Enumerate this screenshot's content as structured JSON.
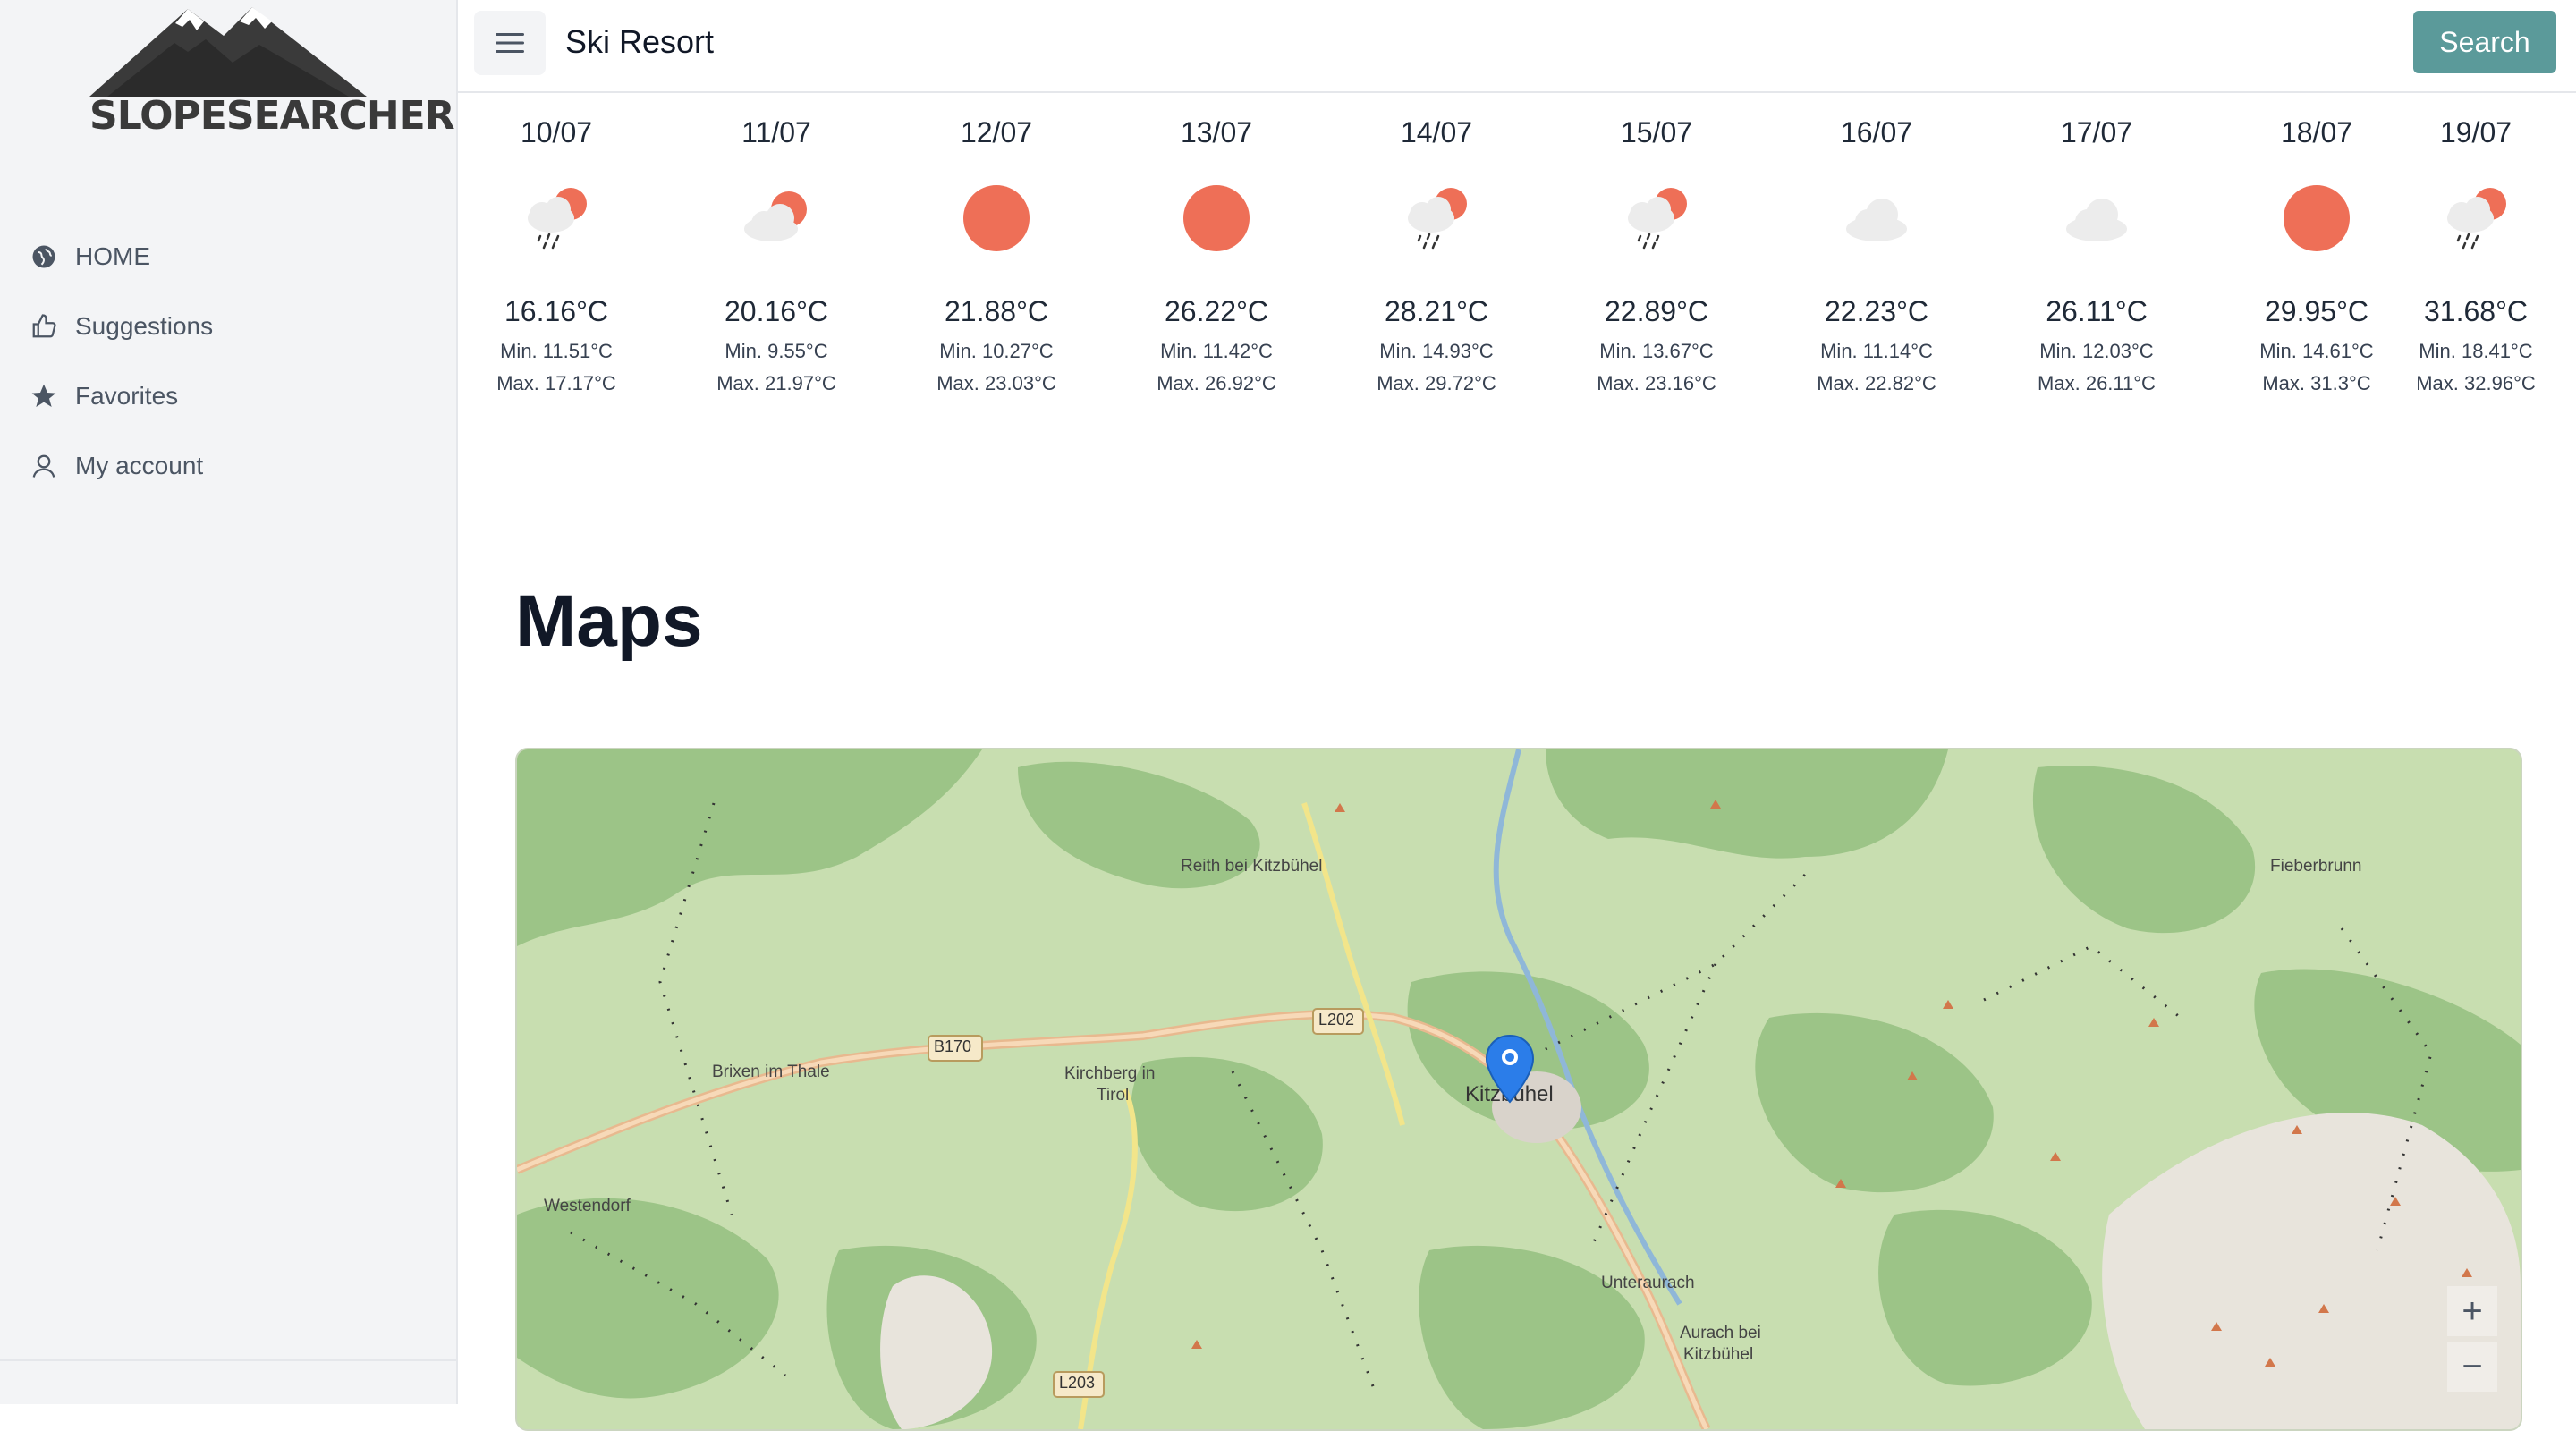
{
  "brand": {
    "logo_text": "SLOPESEARCHER"
  },
  "sidebar": {
    "items": [
      {
        "label": "HOME",
        "icon": "globe-icon"
      },
      {
        "label": "Suggestions",
        "icon": "thumbs-up-icon"
      },
      {
        "label": "Favorites",
        "icon": "star-icon"
      },
      {
        "label": "My account",
        "icon": "user-icon"
      }
    ]
  },
  "header": {
    "title": "Ski Resort",
    "search_label": "Search"
  },
  "forecast": [
    {
      "date": "10/07",
      "icon": "rain-sun-icon",
      "temp": "16.16°C",
      "min": "Min. 11.51°C",
      "max": "Max. 17.17°C"
    },
    {
      "date": "11/07",
      "icon": "cloud-sun-icon",
      "temp": "20.16°C",
      "min": "Min. 9.55°C",
      "max": "Max. 21.97°C"
    },
    {
      "date": "12/07",
      "icon": "sun-icon",
      "temp": "21.88°C",
      "min": "Min. 10.27°C",
      "max": "Max. 23.03°C"
    },
    {
      "date": "13/07",
      "icon": "sun-icon",
      "temp": "26.22°C",
      "min": "Min. 11.42°C",
      "max": "Max. 26.92°C"
    },
    {
      "date": "14/07",
      "icon": "rain-sun-icon",
      "temp": "28.21°C",
      "min": "Min. 14.93°C",
      "max": "Max. 29.72°C"
    },
    {
      "date": "15/07",
      "icon": "rain-sun-icon",
      "temp": "22.89°C",
      "min": "Min. 13.67°C",
      "max": "Max. 23.16°C"
    },
    {
      "date": "16/07",
      "icon": "cloud-icon",
      "temp": "22.23°C",
      "min": "Min. 11.14°C",
      "max": "Max. 22.82°C"
    },
    {
      "date": "17/07",
      "icon": "cloud-icon",
      "temp": "26.11°C",
      "min": "Min. 12.03°C",
      "max": "Max. 26.11°C"
    },
    {
      "date": "18/07",
      "icon": "sun-icon",
      "temp": "29.95°C",
      "min": "Min. 14.61°C",
      "max": "Max. 31.3°C"
    },
    {
      "date": "19/07",
      "icon": "rain-sun-icon",
      "temp": "31.68°C",
      "min": "Min. 18.41°C",
      "max": "Max. 32.96°C"
    }
  ],
  "maps": {
    "heading": "Maps",
    "labels": {
      "reith": "Reith bei Kitzbühel",
      "fieberbrunn": "Fieberbrunn",
      "brixen": "Brixen im Thale",
      "kirchberg": "Kirchberg in",
      "tirol": "Tirol",
      "kitzbuehel": "Kitzbühel",
      "westendorf": "Westendorf",
      "unteraurach": "Unteraurach",
      "aurach": "Aurach bei",
      "aurach2": "Kitzbühel",
      "b170": "B170",
      "l202": "L202",
      "l203": "L203"
    },
    "zoom_in": "+",
    "zoom_out": "−"
  },
  "colors": {
    "accent": "#5b9a9a",
    "sun": "#ee6f57",
    "cloud": "#ececec",
    "forest": "#9cc487",
    "meadow": "#c8deb0",
    "marker": "#2b7de9"
  }
}
